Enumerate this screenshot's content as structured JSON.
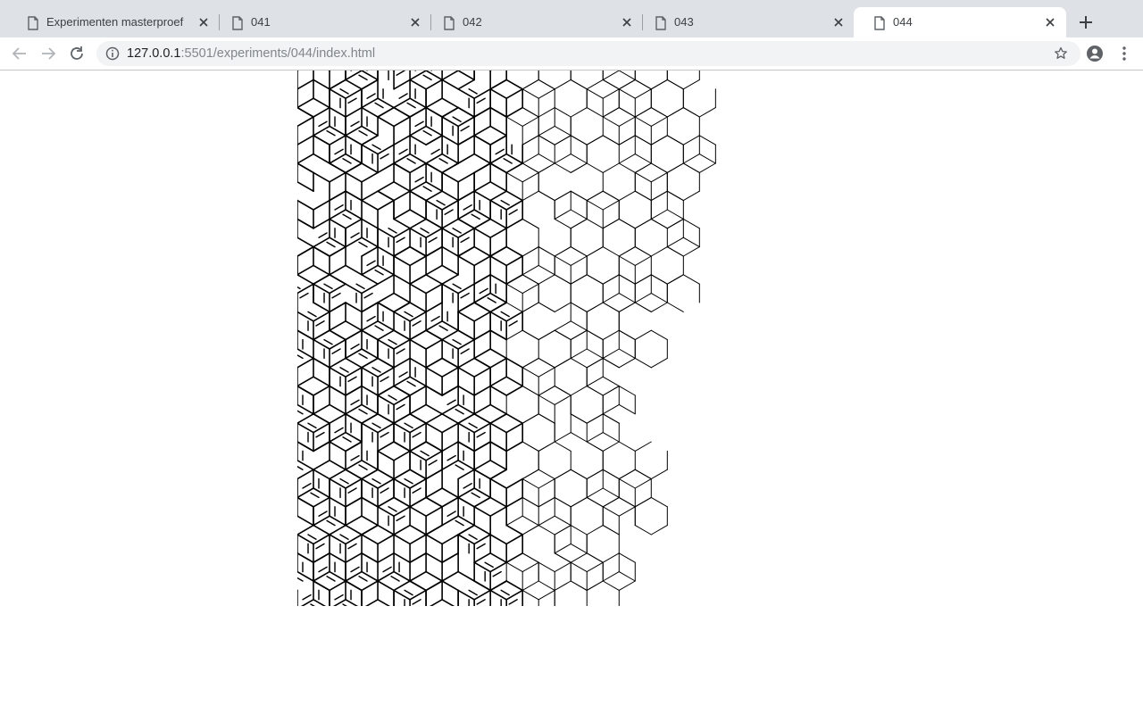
{
  "browser": {
    "tabs": [
      {
        "title": "Experimenten masterproef",
        "active": false
      },
      {
        "title": "041",
        "active": false
      },
      {
        "title": "042",
        "active": false
      },
      {
        "title": "043",
        "active": false
      },
      {
        "title": "044",
        "active": true
      }
    ],
    "url": {
      "host": "127.0.0.1",
      "rest": ":5501/experiments/044/index.html"
    },
    "icons": {
      "tab": "page-icon",
      "close": "close-icon",
      "new_tab": "plus-icon",
      "back": "back-arrow-icon",
      "forward": "forward-arrow-icon",
      "reload": "reload-icon",
      "site_info": "info-icon",
      "bookmark": "star-icon",
      "profile": "profile-icon",
      "menu": "kebab-menu-icon"
    }
  },
  "page": {
    "pattern": "hexagon-triangle-line-pattern",
    "colors": {
      "background": "#ffffff",
      "stroke": "#000000"
    }
  }
}
